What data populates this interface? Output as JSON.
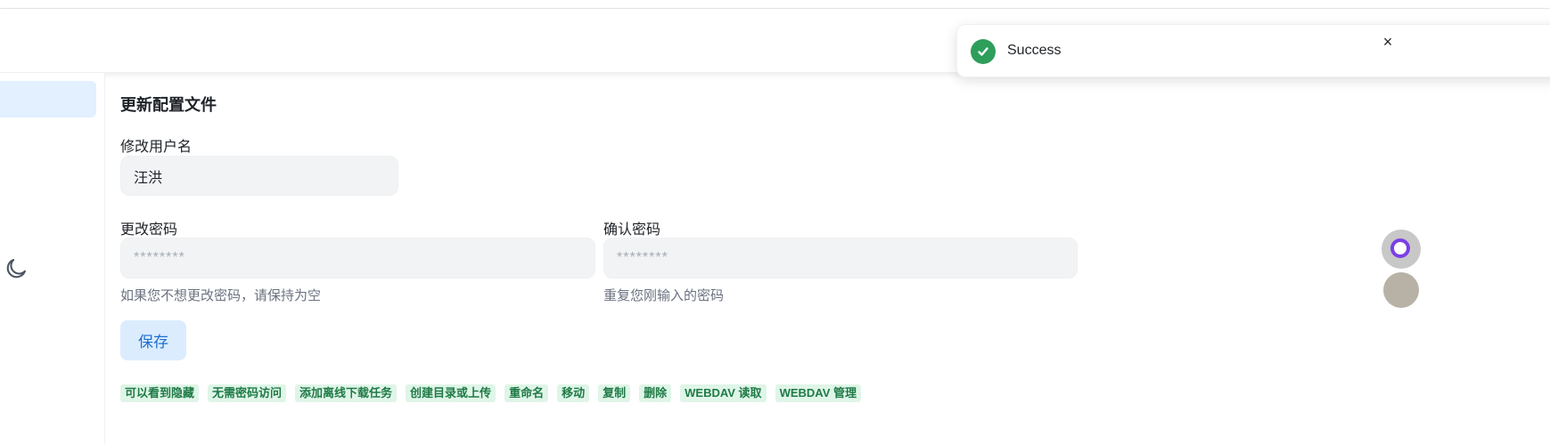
{
  "profile": {
    "section_title": "更新配置文件",
    "username": {
      "label": "修改用户名",
      "value": "汪洪"
    },
    "password": {
      "label": "更改密码",
      "placeholder": "********",
      "hint": "如果您不想更改密码，请保持为空"
    },
    "confirm_password": {
      "label": "确认密码",
      "placeholder": "********",
      "hint": "重复您刚输入的密码"
    },
    "save_label": "保存"
  },
  "permissions": [
    "可以看到隐藏",
    "无需密码访问",
    "添加离线下载任务",
    "创建目录或上传",
    "重命名",
    "移动",
    "复制",
    "删除",
    "WEBDAV 读取",
    "WEBDAV 管理"
  ],
  "toast": {
    "message": "Success",
    "close_symbol": "×"
  },
  "icons": {
    "theme_toggle": "moon-icon",
    "toast_status": "check-circle-icon"
  },
  "colors": {
    "accent": "#1c6fd1",
    "success": "#2e9e5b",
    "tag_background": "#dff5e8",
    "tag_text": "#1f7a46"
  }
}
